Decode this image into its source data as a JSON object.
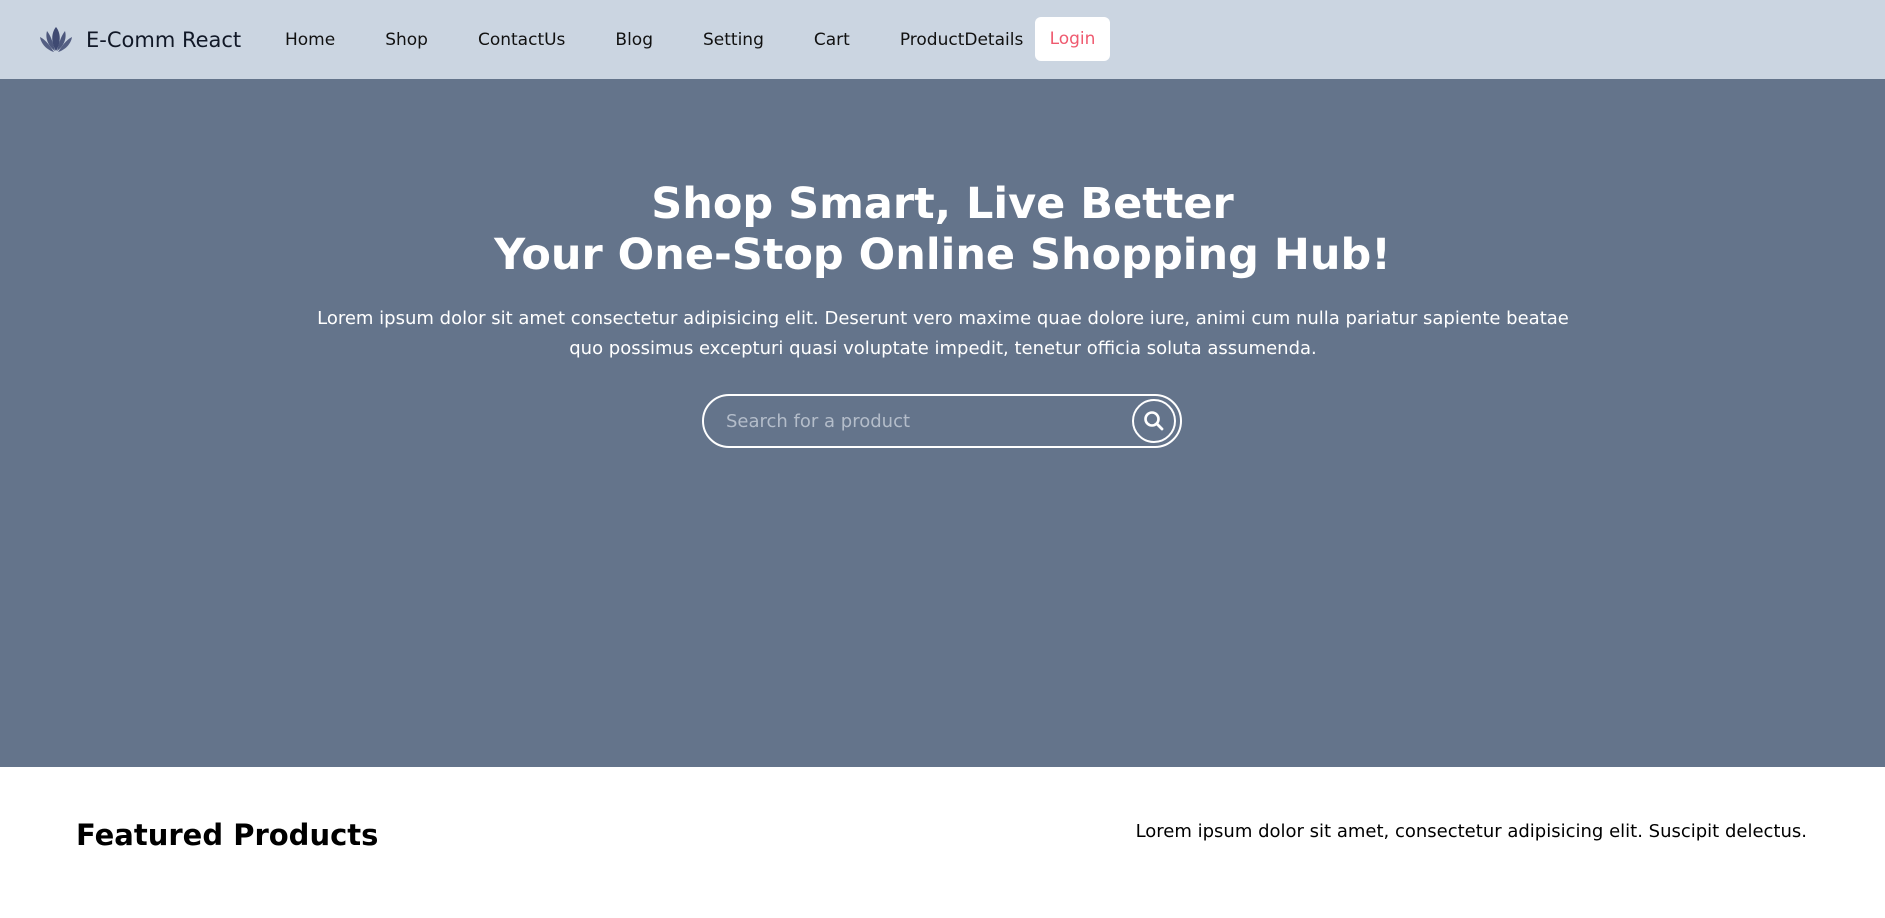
{
  "navbar": {
    "brand_name": "E-Comm React",
    "brand_icon": "lotus-logo-icon",
    "links": [
      "Home",
      "Shop",
      "ContactUs",
      "Blog",
      "Setting",
      "Cart",
      "ProductDetails"
    ],
    "login_label": "Login"
  },
  "hero": {
    "title_line1": "Shop Smart, Live Better",
    "title_line2": "Your One-Stop Online Shopping Hub!",
    "description": "Lorem ipsum dolor sit amet consectetur adipisicing elit. Deserunt vero maxime quae dolore iure, animi cum nulla pariatur sapiente beatae quo possimus excepturi quasi voluptate impedit, tenetur officia soluta assumenda.",
    "search_placeholder": "Search for a product",
    "search_value": ""
  },
  "featured": {
    "title": "Featured Products",
    "description": "Lorem ipsum dolor sit amet, consectetur adipisicing elit. Suscipit delectus."
  },
  "colors": {
    "navbar_bg": "#cbd5e1",
    "hero_bg": "#64748b",
    "login_text": "#ef5a6f"
  }
}
